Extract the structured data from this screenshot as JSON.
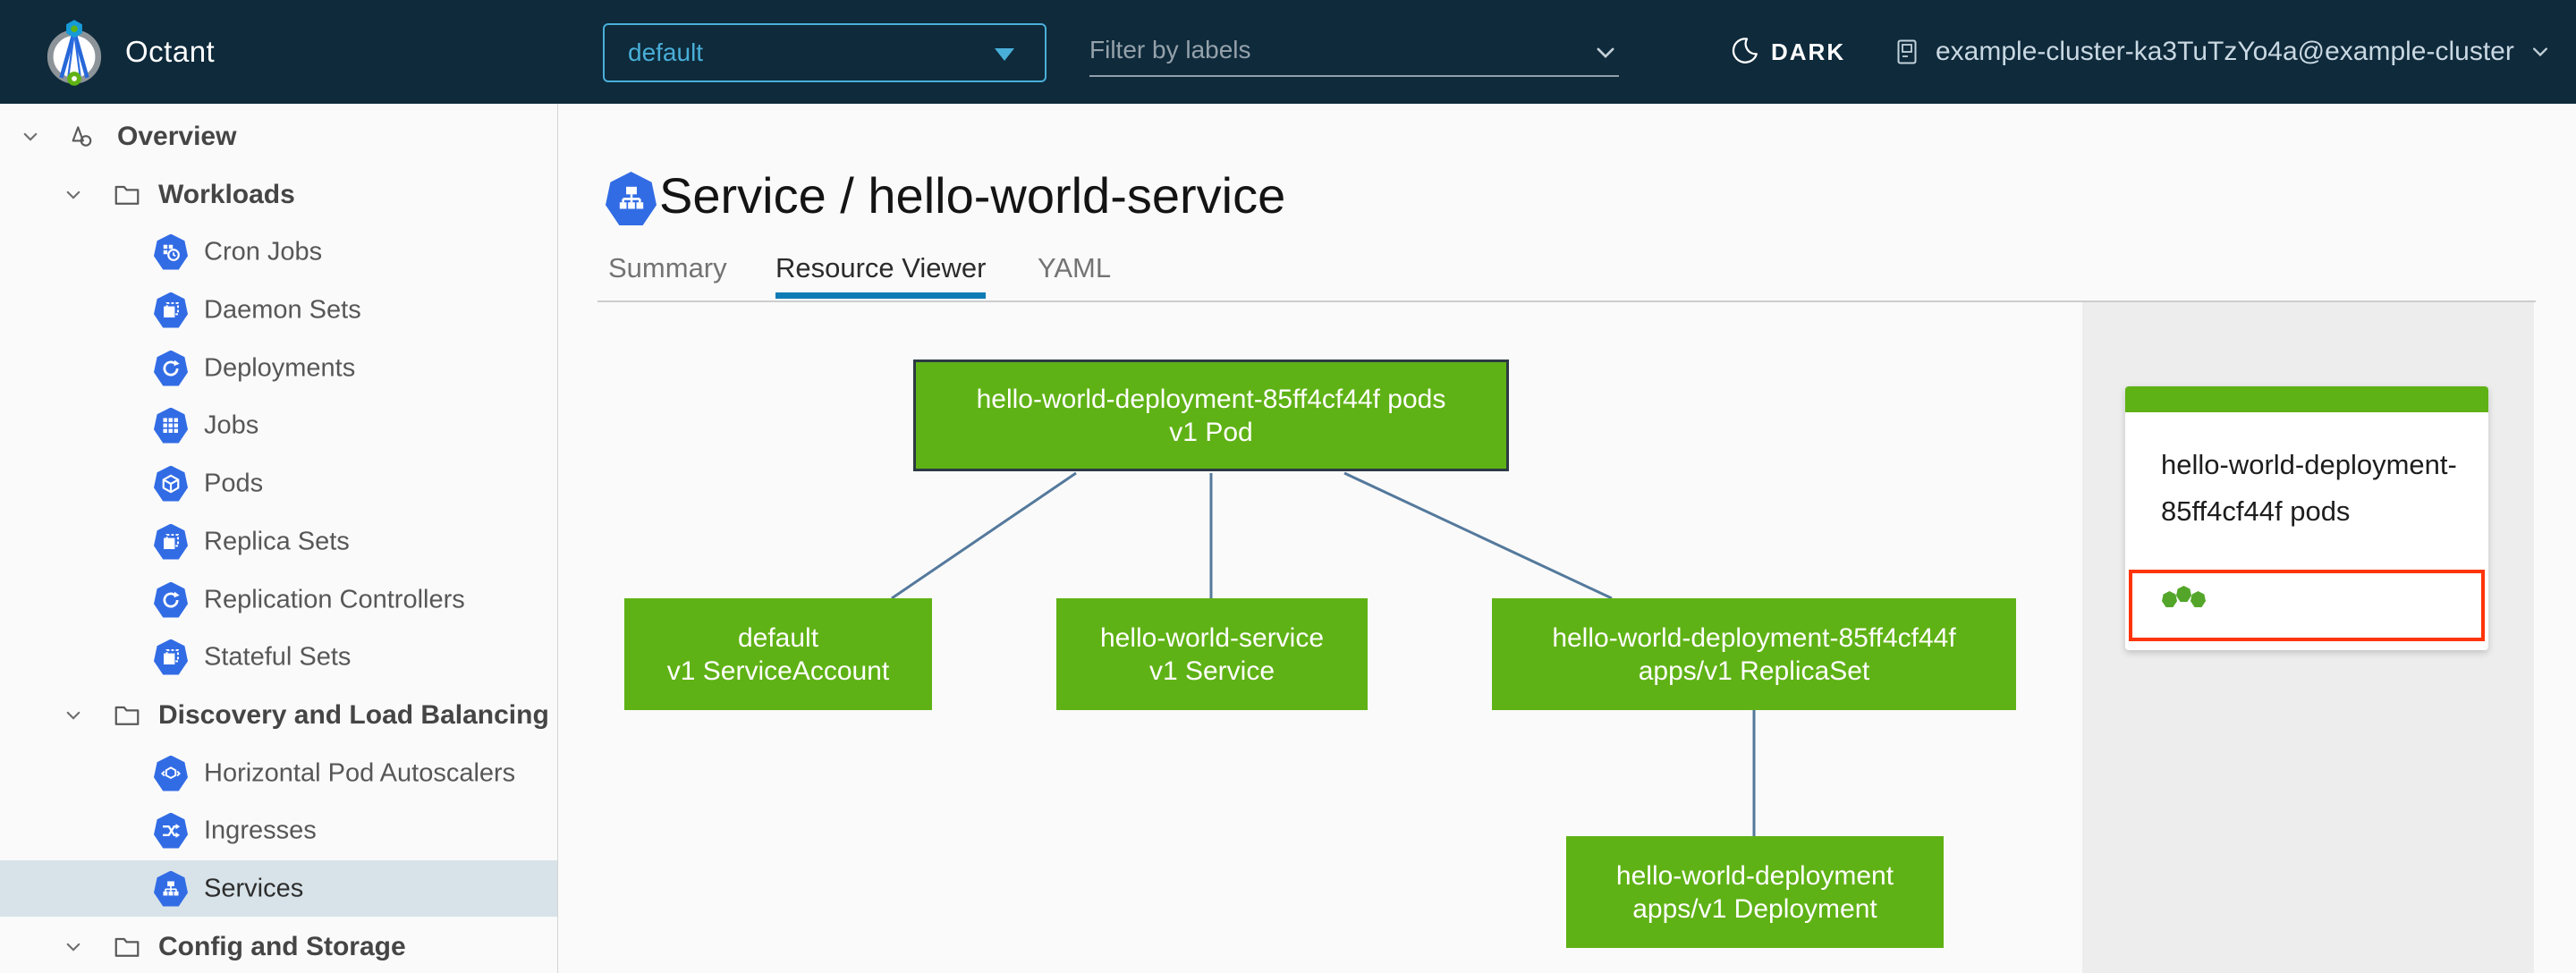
{
  "header": {
    "app_name": "Octant",
    "namespace_select": {
      "value": "default"
    },
    "filter_input": {
      "placeholder": "Filter by labels"
    },
    "theme_toggle_label": "DARK",
    "cluster_context": "example-cluster-ka3TuTzYo4a@example-cluster"
  },
  "sidebar": {
    "items": [
      {
        "label": "Overview",
        "level": 0,
        "icon": "applications-icon",
        "expanded": true,
        "selected": false
      },
      {
        "label": "Workloads",
        "level": 1,
        "icon": "folder-icon",
        "expanded": true,
        "selected": false
      },
      {
        "label": "Cron Jobs",
        "level": 2,
        "icon": "cron-jobs-icon",
        "selected": false
      },
      {
        "label": "Daemon Sets",
        "level": 2,
        "icon": "daemon-sets-icon",
        "selected": false
      },
      {
        "label": "Deployments",
        "level": 2,
        "icon": "deployments-icon",
        "selected": false
      },
      {
        "label": "Jobs",
        "level": 2,
        "icon": "jobs-icon",
        "selected": false
      },
      {
        "label": "Pods",
        "level": 2,
        "icon": "pods-icon",
        "selected": false
      },
      {
        "label": "Replica Sets",
        "level": 2,
        "icon": "replica-sets-icon",
        "selected": false
      },
      {
        "label": "Replication Controllers",
        "level": 2,
        "icon": "replication-controllers-icon",
        "selected": false
      },
      {
        "label": "Stateful Sets",
        "level": 2,
        "icon": "stateful-sets-icon",
        "selected": false
      },
      {
        "label": "Discovery and Load Balancing",
        "level": 1,
        "icon": "folder-icon",
        "expanded": true,
        "selected": false
      },
      {
        "label": "Horizontal Pod Autoscalers",
        "level": 2,
        "icon": "hpa-icon",
        "selected": false
      },
      {
        "label": "Ingresses",
        "level": 2,
        "icon": "ingresses-icon",
        "selected": false
      },
      {
        "label": "Services",
        "level": 2,
        "icon": "services-icon",
        "selected": true
      },
      {
        "label": "Config and Storage",
        "level": 1,
        "icon": "folder-icon",
        "expanded": true,
        "selected": false
      }
    ]
  },
  "main": {
    "page_title": "Service / hello-world-service",
    "tabs": [
      {
        "label": "Summary",
        "active": false
      },
      {
        "label": "Resource Viewer",
        "active": true
      },
      {
        "label": "YAML",
        "active": false
      }
    ],
    "graph": {
      "nodes": [
        {
          "id": "pod",
          "line1": "hello-world-deployment-85ff4cf44f pods",
          "line2": "v1 Pod",
          "status": "ok",
          "selected": true
        },
        {
          "id": "serviceaccount",
          "line1": "default",
          "line2": "v1 ServiceAccount",
          "status": "ok",
          "selected": false
        },
        {
          "id": "service",
          "line1": "hello-world-service",
          "line2": "v1 Service",
          "status": "ok",
          "selected": false
        },
        {
          "id": "replicaset",
          "line1": "hello-world-deployment-85ff4cf44f",
          "line2": "apps/v1 ReplicaSet",
          "status": "ok",
          "selected": false
        },
        {
          "id": "deployment",
          "line1": "hello-world-deployment",
          "line2": "apps/v1 Deployment",
          "status": "ok",
          "selected": false
        }
      ],
      "edges": [
        {
          "from": "pod",
          "to": "serviceaccount"
        },
        {
          "from": "pod",
          "to": "service"
        },
        {
          "from": "pod",
          "to": "replicaset"
        },
        {
          "from": "replicaset",
          "to": "deployment"
        }
      ]
    }
  },
  "detail_panel": {
    "card_title": "hello-world-deployment-85ff4cf44f pods",
    "pod_dots_count": 3,
    "highlighted": true
  },
  "colors": {
    "header_bg": "#0e2a3b",
    "accent_blue": "#49afd9",
    "tab_underline": "#0f7cb4",
    "k8s_icon_blue": "#326ce5",
    "node_green": "#5fb215",
    "status_dot_green": "#53a629",
    "edge_blue": "#54799c",
    "highlight_red": "#ff3408",
    "selected_row_bg": "#d8e3e9",
    "panel_bg": "#ededed"
  }
}
